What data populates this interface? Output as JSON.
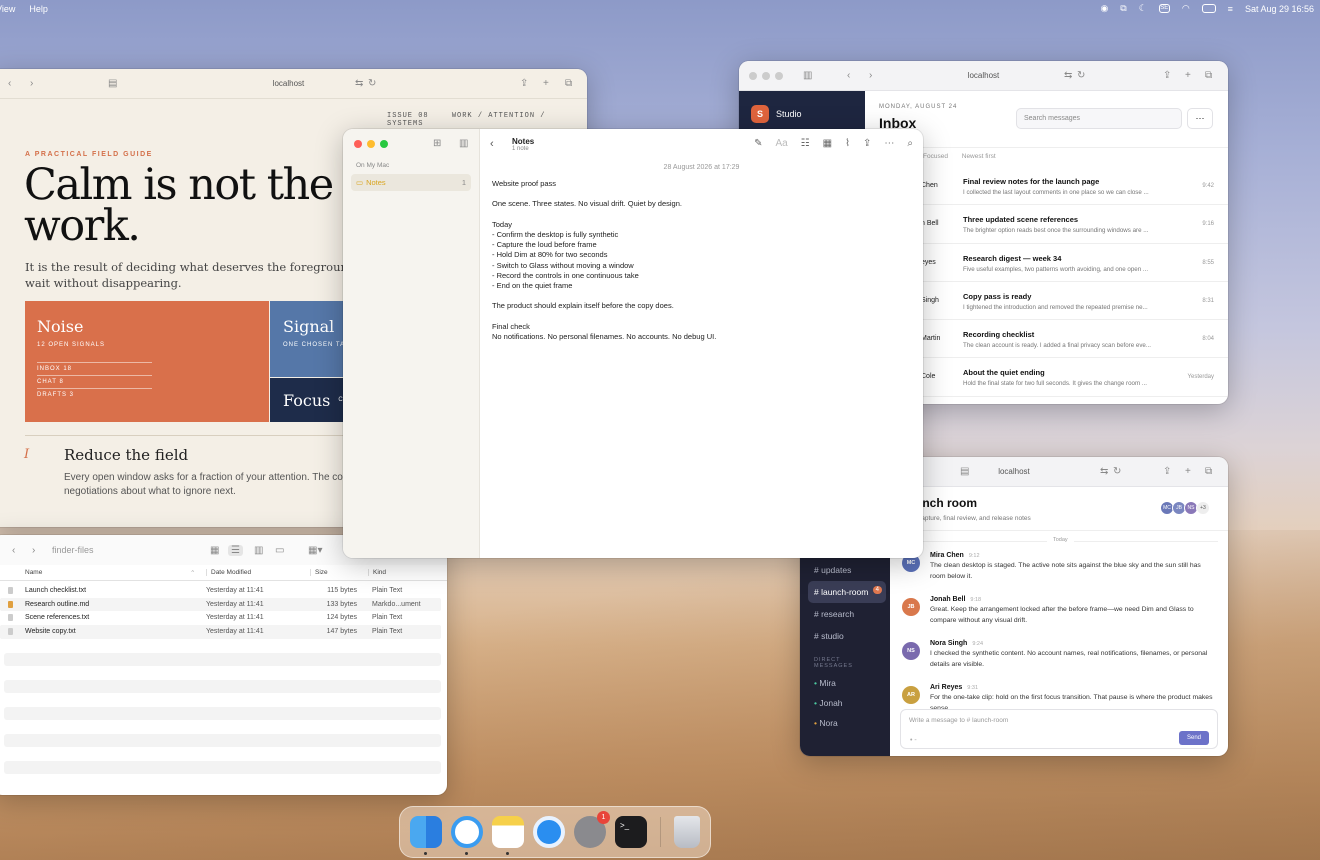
{
  "menubar": {
    "items": [
      "View",
      "Help"
    ],
    "datetime": "Sat Aug 29  16:56"
  },
  "magazine": {
    "url": "localhost",
    "issue": "ISSUE 08",
    "section": "WORK / ATTENTION / SYSTEMS",
    "kicker": "A PRACTICAL FIELD GUIDE",
    "headline1": "Calm is not the abs",
    "headline2": "work.",
    "lede1": "It is the result of deciding what deserves the foreground—and",
    "lede2": "wait without disappearing.",
    "noise": {
      "title": "Noise",
      "sub": "12 OPEN SIGNALS",
      "rows": [
        "INBOX 18",
        "CHAT 8",
        "DRAFTS 3"
      ]
    },
    "signal": {
      "title": "Signal",
      "sub": "ONE CHOSEN TA"
    },
    "focus": {
      "title": "Focus",
      "sub": "C"
    },
    "numeral": "I",
    "section_title": "Reduce the field",
    "body1": "Every open window asks for a fraction of your attention. The cos",
    "body2": "negotiations about what to ignore next."
  },
  "notes": {
    "title": "Notes",
    "count": "1 note",
    "sidebar_header": "On My Mac",
    "folder": "Notes",
    "folder_count": "1",
    "date": "28 August 2026 at 17:29",
    "lines": [
      "Website proof pass",
      "",
      "One scene. Three states. No visual drift. Quiet by design.",
      "",
      "Today",
      "- Confirm the desktop is fully synthetic",
      "- Capture the loud before frame",
      "- Hold Dim at 80% for two seconds",
      "- Switch to Glass without moving a window",
      "- Record the controls in one continuous take",
      "- End on the quiet frame",
      "",
      "The product should explain itself before the copy does.",
      "",
      "Final check",
      "No notifications. No personal filenames. No accounts. No debug UI."
    ]
  },
  "mail": {
    "url": "localhost",
    "brand": "Studio",
    "brand_initial": "S",
    "date": "MONDAY, AUGUST 24",
    "title": "Inbox",
    "search_placeholder": "Search messages",
    "filters": [
      "Focused",
      "Newest first"
    ],
    "messages": [
      {
        "from": "Chen",
        "subject": "Final review notes for the launch page",
        "preview": "I collected the last layout comments in one place so we can close ...",
        "time": "9:42"
      },
      {
        "from": "n Bell",
        "subject": "Three updated scene references",
        "preview": "The brighter option reads best once the surrounding windows are ...",
        "time": "9:16"
      },
      {
        "from": "eyes",
        "subject": "Research digest — week 34",
        "preview": "Five useful examples, two patterns worth avoiding, and one open ...",
        "time": "8:55"
      },
      {
        "from": "Singh",
        "subject": "Copy pass is ready",
        "preview": "I tightened the introduction and removed the repeated premise ne...",
        "time": "8:31"
      },
      {
        "from": "Martin",
        "subject": "Recording checklist",
        "preview": "The clean account is ready. I added a final privacy scan before eve...",
        "time": "8:04"
      },
      {
        "from": "Cole",
        "subject": "About the quiet ending",
        "preview": "Hold the final state for two full seconds. It gives the change room ...",
        "time": "Yesterday"
      }
    ]
  },
  "chat": {
    "url": "localhost",
    "room": "unch room",
    "subtitle": "capture, final review, and release notes",
    "avatars": [
      "MC",
      "JB",
      "NS"
    ],
    "avatar_more": "+3",
    "divider": "Today",
    "channels": [
      {
        "label": "# updates"
      },
      {
        "label": "# launch-room",
        "badge": "4"
      },
      {
        "label": "# research"
      },
      {
        "label": "# studio"
      }
    ],
    "dm_header": "DIRECT MESSAGES",
    "dms": [
      "Mira",
      "Jonah",
      "Nora"
    ],
    "messages": [
      {
        "initials": "MC",
        "name": "Mira Chen",
        "time": "9:12",
        "text": "The clean desktop is staged. The active note sits against the blue sky and the sun still has room below it.",
        "color": "#5a70b8"
      },
      {
        "initials": "JB",
        "name": "Jonah Bell",
        "time": "9:18",
        "text": "Great. Keep the arrangement locked after the before frame—we need Dim and Glass to compare without any visual drift.",
        "color": "#d9784c"
      },
      {
        "initials": "NS",
        "name": "Nora Singh",
        "time": "9:24",
        "text": "I checked the synthetic content. No account names, real notifications, filenames, or personal details are visible.",
        "color": "#7a6aae"
      },
      {
        "initials": "AR",
        "name": "Ari Reyes",
        "time": "9:31",
        "text": "For the one-take clip: hold on the first focus transition. That pause is where the product makes sense.",
        "color": "#c9a040"
      }
    ],
    "composer_placeholder": "Write a message to # launch-room",
    "send": "Send"
  },
  "finder": {
    "title": "finder-files",
    "columns": [
      "Name",
      "Date Modified",
      "Size",
      "Kind"
    ],
    "rows": [
      {
        "name": "Launch checklist.txt",
        "date": "Yesterday at 11:41",
        "size": "115 bytes",
        "kind": "Plain Text"
      },
      {
        "name": "Research outline.md",
        "date": "Yesterday at 11:41",
        "size": "133 bytes",
        "kind": "Markdo...ument"
      },
      {
        "name": "Scene references.txt",
        "date": "Yesterday at 11:41",
        "size": "124 bytes",
        "kind": "Plain Text"
      },
      {
        "name": "Website copy.txt",
        "date": "Yesterday at 11:41",
        "size": "147 bytes",
        "kind": "Plain Text"
      }
    ]
  },
  "dock": {
    "settings_badge": "1",
    "apps": [
      "finder-icon",
      "safari-icon",
      "notes-icon",
      "quicktime-icon",
      "settings-icon",
      "terminal-icon",
      "trash-icon"
    ]
  }
}
